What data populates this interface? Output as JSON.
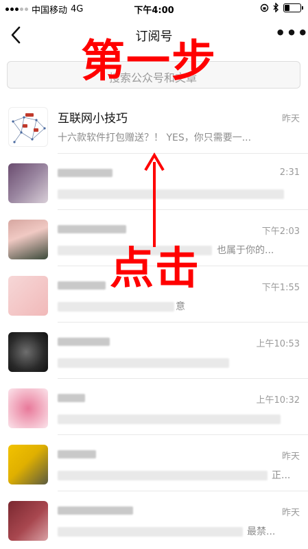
{
  "status": {
    "carrier": "中国移动",
    "network": "4G",
    "time": "下午4:00",
    "battery_level": 0.35
  },
  "nav": {
    "title": "订阅号",
    "back_icon": "chevron-left-icon",
    "more_label": "•••"
  },
  "search": {
    "placeholder": "搜索公众号和文章"
  },
  "annotations": {
    "step": "第一步",
    "click": "点击",
    "color": "#ff0000"
  },
  "items": [
    {
      "title": "互联网小技巧",
      "preview": "十六款软件打包赠送？！ YES，你只需要一...",
      "time": "昨天"
    },
    {
      "title": "",
      "preview": "",
      "time": "2:31"
    },
    {
      "title": "",
      "preview": "也属于你的...",
      "time": "下午2:03"
    },
    {
      "title": "",
      "preview": "意",
      "time": "下午1:55"
    },
    {
      "title": "",
      "preview": "",
      "time": "上午10:53"
    },
    {
      "title": "",
      "preview": "",
      "time": "上午10:32"
    },
    {
      "title": "",
      "preview": "正...",
      "time": "昨天"
    },
    {
      "title": "",
      "preview": "最禁...",
      "time": "昨天"
    }
  ]
}
